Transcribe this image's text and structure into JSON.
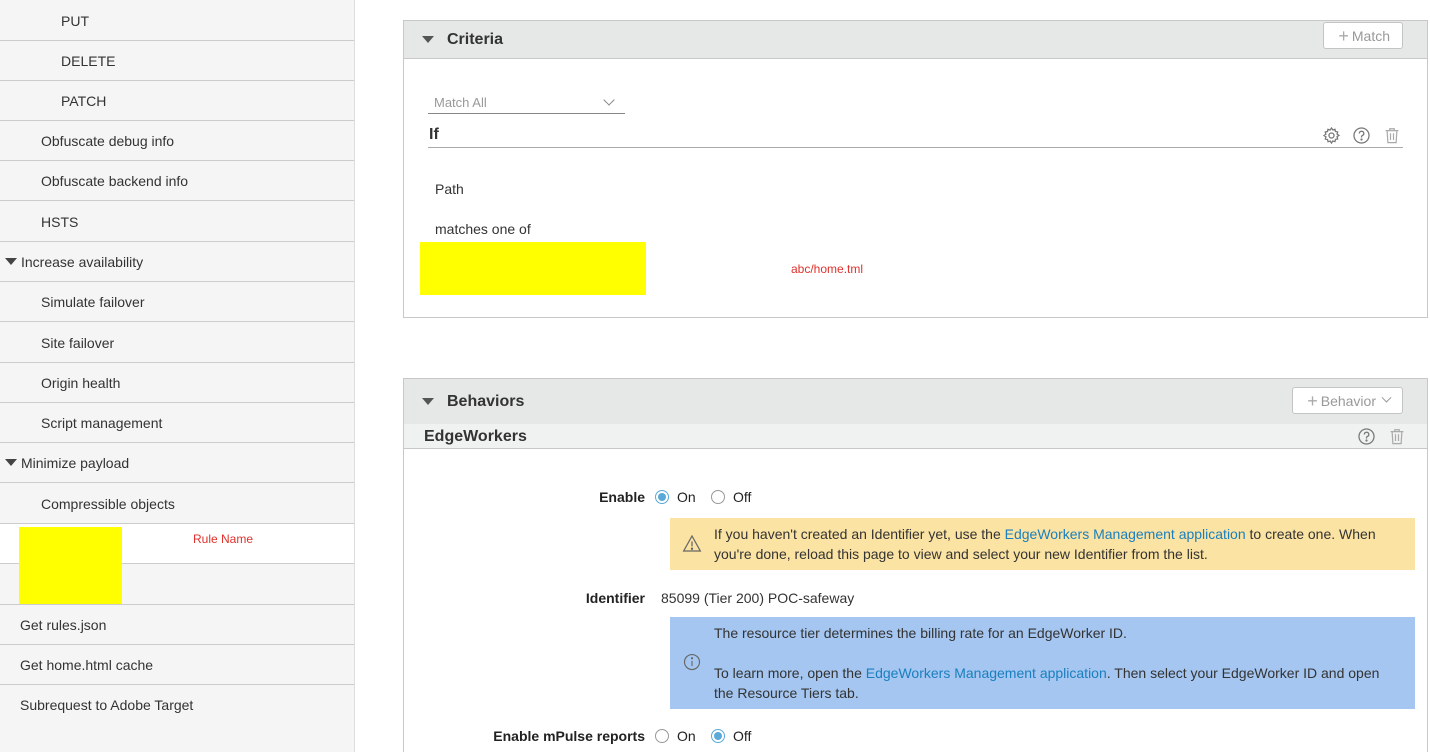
{
  "sidebar": {
    "items": [
      {
        "label": "PUT",
        "level": 2
      },
      {
        "label": "DELETE",
        "level": 2
      },
      {
        "label": "PATCH",
        "level": 2
      },
      {
        "label": "Obfuscate debug info",
        "level": 1
      },
      {
        "label": "Obfuscate backend info",
        "level": 1
      },
      {
        "label": "HSTS",
        "level": 1
      },
      {
        "label": "Increase availability",
        "level": 0
      },
      {
        "label": "Simulate failover",
        "level": 1
      },
      {
        "label": "Site failover",
        "level": 1
      },
      {
        "label": "Origin health",
        "level": 1
      },
      {
        "label": "Script management",
        "level": 1
      },
      {
        "label": "Minimize payload",
        "level": 0
      },
      {
        "label": "Compressible objects",
        "level": 1
      }
    ],
    "redacted_rule_label": "Rule Name",
    "bottom_items": [
      {
        "label": "Get rules.json"
      },
      {
        "label": "Get home.html cache"
      },
      {
        "label": "Subrequest to Adobe Target"
      }
    ]
  },
  "criteria": {
    "title": "Criteria",
    "add_button": "Match",
    "match_select": "Match All",
    "if_label": "If",
    "condition_field": "Path",
    "condition_operator": "matches one of",
    "redacted_value_label": "abc/home.tml"
  },
  "behaviors": {
    "title": "Behaviors",
    "add_button": "Behavior",
    "behavior_name": "EdgeWorkers",
    "enable": {
      "label": "Enable",
      "on": "On",
      "off": "Off",
      "selected": "On"
    },
    "warning": {
      "text_before": "If you haven't created an Identifier yet, use the ",
      "link": "EdgeWorkers Management application",
      "text_after": " to create one. When you're done, reload this page to view and select your new Identifier from the list."
    },
    "identifier": {
      "label": "Identifier",
      "value": "85099 (Tier 200) POC-safeway"
    },
    "info": {
      "line1": "The resource tier determines the billing rate for an EdgeWorker ID.",
      "text_before": "To learn more, open the ",
      "link": "EdgeWorkers Management application",
      "text_after": ". Then select your EdgeWorker ID and open the Resource Tiers tab."
    },
    "mpulse": {
      "label": "Enable mPulse reports",
      "on": "On",
      "off": "Off",
      "selected": "Off"
    }
  },
  "colors": {
    "redaction": "#ffff00",
    "redaction_label": "#e0312c",
    "link": "#1a7fbf",
    "warning_bg": "#fbe3a3",
    "info_bg": "#a4c6f0",
    "radio_checked": "#5aa9d6"
  },
  "icons": {
    "settings": "gear-icon",
    "help": "question-circle-icon",
    "delete": "trash-icon",
    "warning": "warning-triangle-icon",
    "info": "info-circle-icon"
  }
}
